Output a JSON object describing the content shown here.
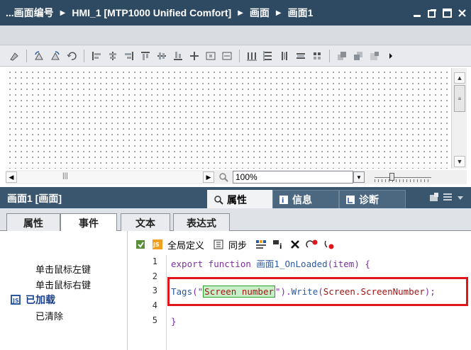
{
  "breadcrumb": {
    "items": [
      "...画面编号",
      "HMI_1 [MTP1000 Unified Comfort]",
      "画面",
      "画面1"
    ]
  },
  "canvas": {
    "zoom_value": "100%"
  },
  "inspector": {
    "object_title": "画面1 [画面]",
    "tabs": [
      {
        "label": "属性",
        "active": true
      },
      {
        "label": "信息",
        "active": false
      },
      {
        "label": "诊断",
        "active": false
      }
    ],
    "subtabs": [
      {
        "label": "属性",
        "active": false
      },
      {
        "label": "事件",
        "active": true
      },
      {
        "label": "文本",
        "active": false
      },
      {
        "label": "表达式",
        "active": false
      }
    ],
    "events": {
      "items": [
        "单击鼠标左键",
        "单击鼠标右键",
        "已加载",
        "已清除"
      ],
      "selected": "已加载"
    },
    "editor_toolbar": {
      "global_definition_label": "全局定义",
      "sync_label": "同步"
    },
    "code": {
      "line_numbers": [
        "1",
        "2",
        "3",
        "4",
        "5"
      ],
      "line1": {
        "kw": "export function",
        "name": "画面1_OnLoaded",
        "args": "(item) {"
      },
      "line3": {
        "obj": "Tags",
        "open": "(\"",
        "arg": "Screen number",
        "close": "\").",
        "method": "Write",
        "paren": "(",
        "value": "Screen.ScreenNumber",
        "end": ");"
      },
      "line5": "}"
    }
  },
  "colors": {
    "titlebar": "#2e4a62",
    "highlight_box": "#e0161b",
    "selected_event": "#1a3f8f"
  }
}
